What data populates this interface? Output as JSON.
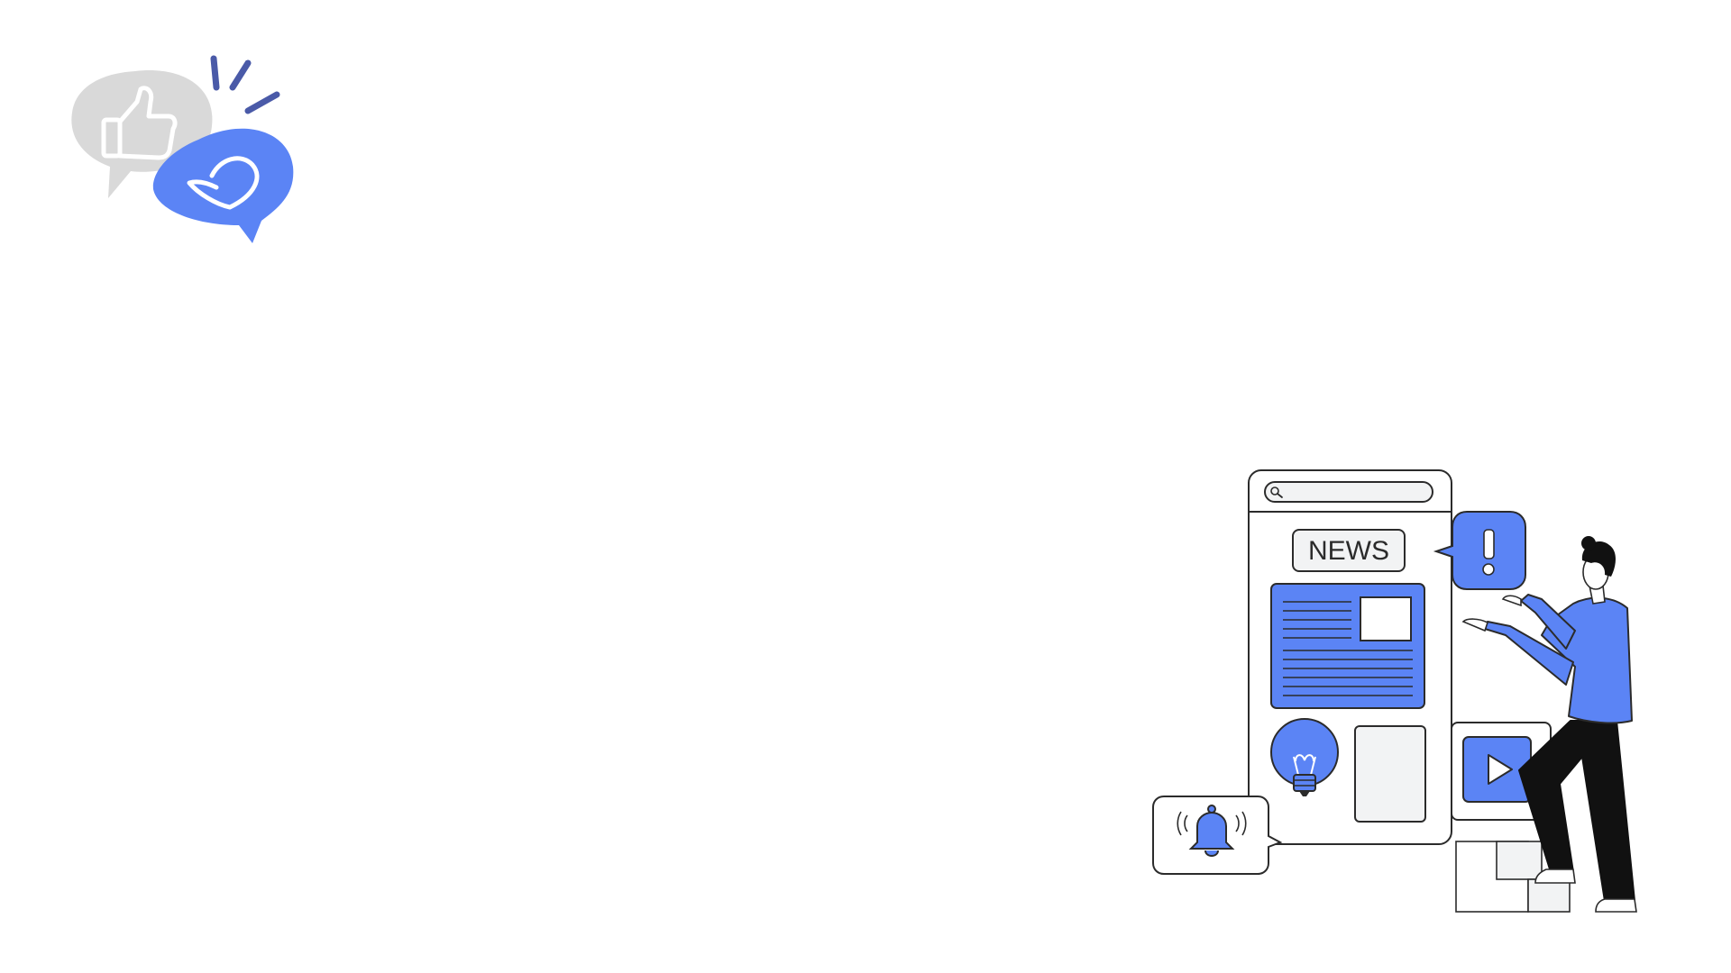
{
  "logo": {
    "icon": "thumbs-up-heart-speech-bubbles"
  },
  "illustration": {
    "news_label": "NEWS",
    "accent_color": "#5b84f5",
    "dark_accent": "#4a5aa8",
    "outline_color": "#2b2b2b",
    "panel_gray": "#f2f3f4"
  }
}
